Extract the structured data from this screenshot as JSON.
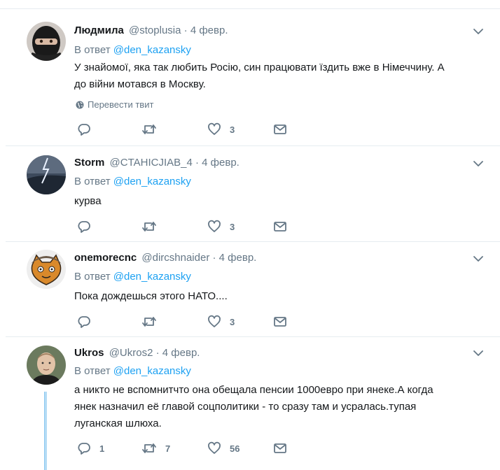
{
  "colors": {
    "link": "#1da1f2",
    "muted": "#657786",
    "text": "#14171a",
    "divider": "#e6ecf0",
    "thread": "#b5dcf5"
  },
  "tweets": [
    {
      "name": "Людмила",
      "handle": "@stoplusia",
      "dot": "·",
      "date": "4 февр.",
      "reply_prefix": "В ответ",
      "reply_mention": "@den_kazansky",
      "text_lines": [
        "У знайомої, яка так любить Росію, син працювати їздить вже в Німеччину. А",
        "до війни мотався в Москву."
      ],
      "translate": "Перевести твит",
      "replies": "",
      "retweets": "",
      "likes": "3",
      "avatar": "masked-person"
    },
    {
      "name": "Storm",
      "handle": "@CTAHICJIAB_4",
      "dot": "·",
      "date": "4 февр.",
      "reply_prefix": "В ответ",
      "reply_mention": "@den_kazansky",
      "text_lines": [
        "курва"
      ],
      "replies": "",
      "retweets": "",
      "likes": "3",
      "avatar": "lightning-storm"
    },
    {
      "name": "onemorecnc",
      "handle": "@dircshnaider",
      "dot": "·",
      "date": "4 февр.",
      "reply_prefix": "В ответ",
      "reply_mention": "@den_kazansky",
      "text_lines": [
        "Пока дождешься этого НАТО...."
      ],
      "replies": "",
      "retweets": "",
      "likes": "3",
      "avatar": "cartoon-cat"
    },
    {
      "name": "Ukros",
      "handle": "@Ukros2",
      "dot": "·",
      "date": "4 февр.",
      "reply_prefix": "В ответ",
      "reply_mention": "@den_kazansky",
      "text_lines": [
        "а никто не вспомнитчто она обещала пенсии 1000евро при янеке.А когда",
        "янек назначил её главой соцполитики - то сразу там и усралась.тупая",
        "луганская шлюха."
      ],
      "replies": "1",
      "retweets": "7",
      "likes": "56",
      "avatar": "young-man"
    }
  ]
}
